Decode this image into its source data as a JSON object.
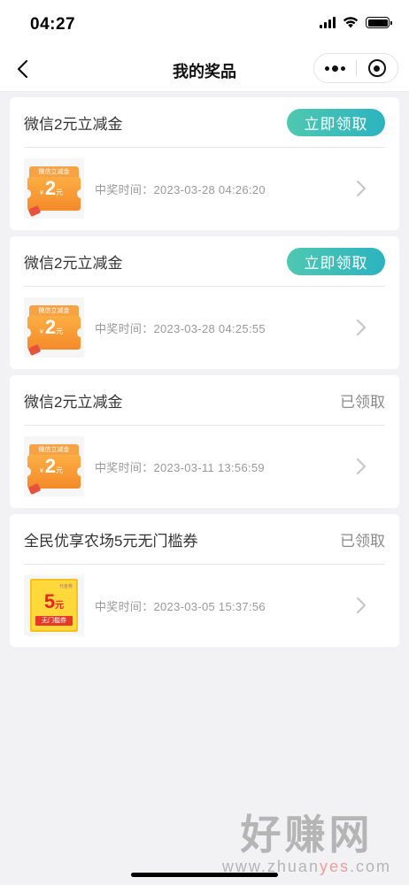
{
  "status_bar": {
    "time": "04:27"
  },
  "nav": {
    "title": "我的奖品"
  },
  "prizes": [
    {
      "name": "微信2元立减金",
      "action": "立即领取",
      "claimed": false,
      "won_time": "中奖时间：2023-03-28 04:26:20",
      "coupon": {
        "header": "微信立减金",
        "amount": "2",
        "unit": "元",
        "currency": "¥"
      }
    },
    {
      "name": "微信2元立减金",
      "action": "立即领取",
      "claimed": false,
      "won_time": "中奖时间：2023-03-28 04:25:55",
      "coupon": {
        "header": "微信立减金",
        "amount": "2",
        "unit": "元",
        "currency": "¥"
      }
    },
    {
      "name": "微信2元立减金",
      "action": "已领取",
      "claimed": true,
      "won_time": "中奖时间：2023-03-11 13:56:59",
      "coupon": {
        "header": "微信立减金",
        "amount": "2",
        "unit": "元",
        "currency": "¥"
      }
    },
    {
      "name": "全民优享农场5元无门槛券",
      "action": "已领取",
      "claimed": true,
      "won_time": "中奖时间：2023-03-05 15:37:56",
      "coupon": {
        "tag": "代金券",
        "amount": "5",
        "unit": "元",
        "footer": "无门槛券"
      }
    }
  ],
  "watermark": {
    "main": "好赚网",
    "url_prefix": "www.zhuan",
    "url_accent": "yes",
    "url_suffix": ".com"
  },
  "colors": {
    "claim_gradient_start": "#4fc8b1",
    "claim_gradient_end": "#2bb3c0",
    "claimed_text": "#8a8a8a"
  }
}
